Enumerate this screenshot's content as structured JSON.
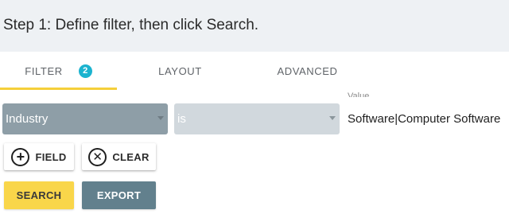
{
  "header": {
    "step_text": "Step 1: Define filter, then click Search."
  },
  "tabs": [
    {
      "label": "FILTER",
      "badge": "2",
      "active": true
    },
    {
      "label": "LAYOUT"
    },
    {
      "label": "ADVANCED"
    }
  ],
  "filter_row": {
    "field_select": {
      "value": "Industry",
      "icon": "chevron-down-icon"
    },
    "operator_select": {
      "value": "is",
      "icon": "chevron-down-icon"
    },
    "value_input": {
      "label": "Value",
      "value": "Software|Computer Software"
    }
  },
  "buttons": {
    "add_field": {
      "label": "FIELD",
      "icon": "plus-circle-icon"
    },
    "clear": {
      "label": "CLEAR",
      "icon": "x-circle-icon"
    },
    "search": {
      "label": "SEARCH"
    },
    "export": {
      "label": "EXPORT"
    }
  },
  "colors": {
    "active_tab_indicator": "#f5cf3a",
    "badge": "#1bb3cf",
    "field_select_bg": "#8e9ea7",
    "operator_select_bg": "#d1d8dd",
    "search_button": "#f9d64a",
    "export_button": "#62808d"
  }
}
